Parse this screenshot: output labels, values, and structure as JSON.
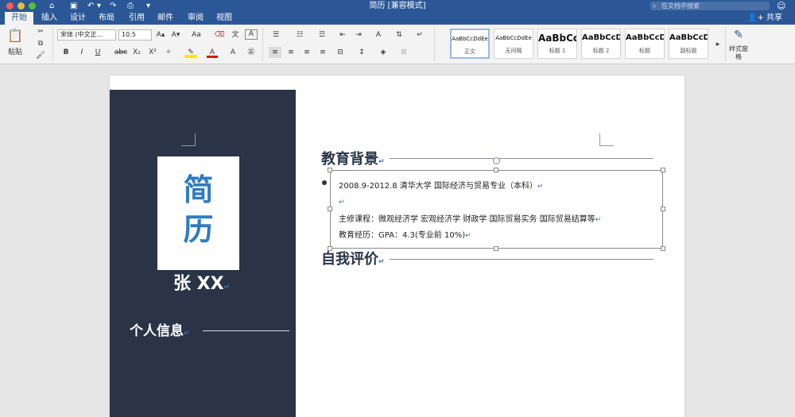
{
  "window": {
    "title": "简历 [兼容模式]",
    "search_placeholder": "在文档中搜索"
  },
  "tabs": [
    "开始",
    "插入",
    "设计",
    "布局",
    "引用",
    "邮件",
    "审阅",
    "视图"
  ],
  "share_label": "共享",
  "ribbon": {
    "paste_label": "粘贴",
    "font_name": "宋体 (中文正...",
    "font_size": "10.5",
    "bold": "B",
    "italic": "I",
    "underline": "U",
    "strike": "abc",
    "subscript": "X₂",
    "superscript": "X²",
    "font_color_letter": "A",
    "grow_font": "A▴",
    "shrink_font": "A▾",
    "change_case": "Aa",
    "char_border": "A",
    "phonetic": "文",
    "styles": [
      {
        "preview": "AaBbCcDdEe",
        "label": "正文"
      },
      {
        "preview": "AaBbCcDdEe",
        "label": "无间隔"
      },
      {
        "preview": "AaBbCc",
        "label": "标题 1"
      },
      {
        "preview": "AaBbCcD",
        "label": "标题 2"
      },
      {
        "preview": "AaBbCcD",
        "label": "标题"
      },
      {
        "preview": "AaBbCcD",
        "label": "副标题"
      }
    ],
    "styles_pane_label": "样式窗格"
  },
  "resume": {
    "photo_chars": [
      "简",
      "历"
    ],
    "name": "张 XX",
    "personal_info_heading": "个人信息",
    "education_heading": "教育背景",
    "education_line1": "2008.9-2012.8      清华大学      国际经济与贸易专业（本科）",
    "courses": "主修课程：微观经济学  宏观经济学  财政学  国际贸易实务  国际贸易结算等",
    "experience": "教育经历：GPA：4.3(专业前 10%)",
    "self_eval_heading": "自我评价"
  },
  "colors": {
    "brand_blue": "#2b5797",
    "sidebar_navy": "#2a3446",
    "photo_text_blue": "#2e7cc2"
  }
}
